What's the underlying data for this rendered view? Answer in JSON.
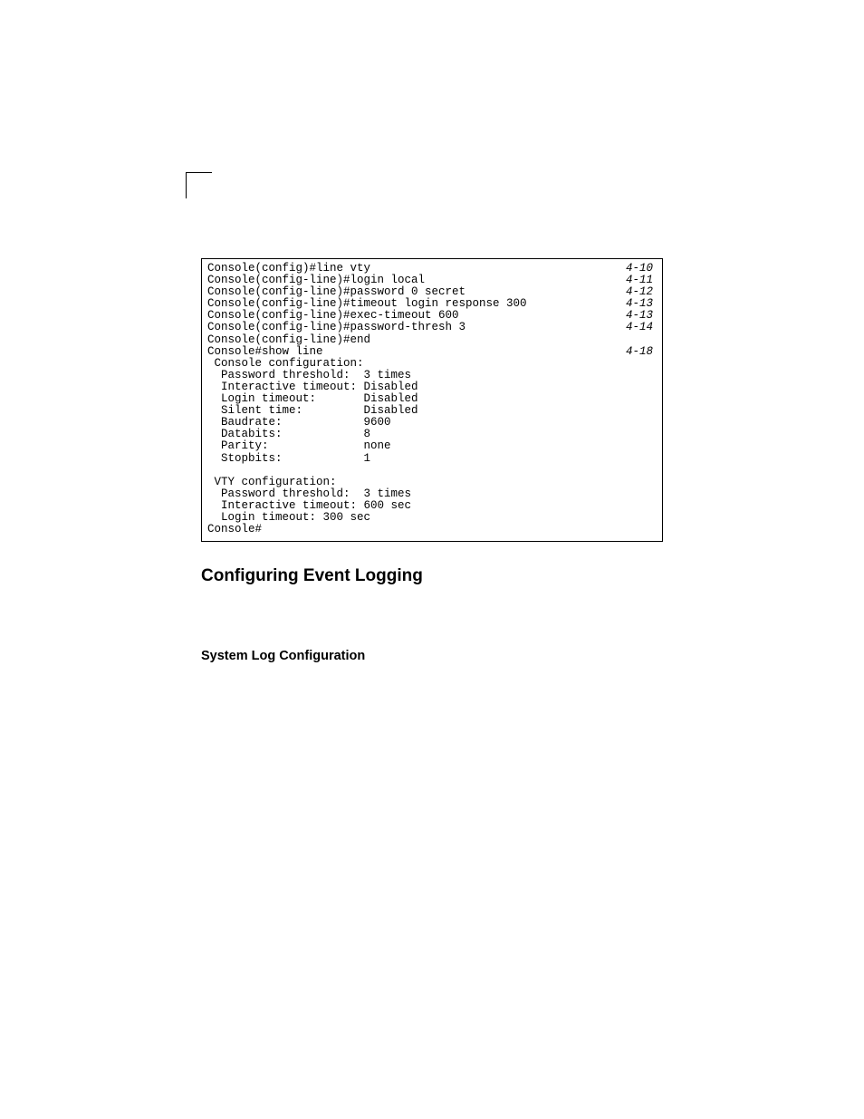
{
  "terminal": {
    "rows": [
      {
        "cmd": "Console(config)#line vty",
        "ref": "4-10"
      },
      {
        "cmd": "Console(config-line)#login local",
        "ref": "4-11"
      },
      {
        "cmd": "Console(config-line)#password 0 secret",
        "ref": "4-12"
      },
      {
        "cmd": "Console(config-line)#timeout login response 300",
        "ref": "4-13"
      },
      {
        "cmd": "Console(config-line)#exec-timeout 600",
        "ref": "4-13"
      },
      {
        "cmd": "Console(config-line)#password-thresh 3",
        "ref": "4-14"
      },
      {
        "cmd": "Console(config-line)#end",
        "ref": ""
      },
      {
        "cmd": "Console#show line",
        "ref": "4-18"
      },
      {
        "cmd": " Console configuration:",
        "ref": ""
      },
      {
        "cmd": "  Password threshold:  3 times",
        "ref": ""
      },
      {
        "cmd": "  Interactive timeout: Disabled",
        "ref": ""
      },
      {
        "cmd": "  Login timeout:       Disabled",
        "ref": ""
      },
      {
        "cmd": "  Silent time:         Disabled",
        "ref": ""
      },
      {
        "cmd": "  Baudrate:            9600",
        "ref": ""
      },
      {
        "cmd": "  Databits:            8",
        "ref": ""
      },
      {
        "cmd": "  Parity:              none",
        "ref": ""
      },
      {
        "cmd": "  Stopbits:            1",
        "ref": ""
      },
      {
        "cmd": "",
        "ref": ""
      },
      {
        "cmd": " VTY configuration:",
        "ref": ""
      },
      {
        "cmd": "  Password threshold:  3 times",
        "ref": ""
      },
      {
        "cmd": "  Interactive timeout: 600 sec",
        "ref": ""
      },
      {
        "cmd": "  Login timeout: 300 sec",
        "ref": ""
      },
      {
        "cmd": "Console#",
        "ref": ""
      }
    ]
  },
  "headings": {
    "h1": "Configuring Event Logging",
    "h2": "System Log Configuration"
  }
}
